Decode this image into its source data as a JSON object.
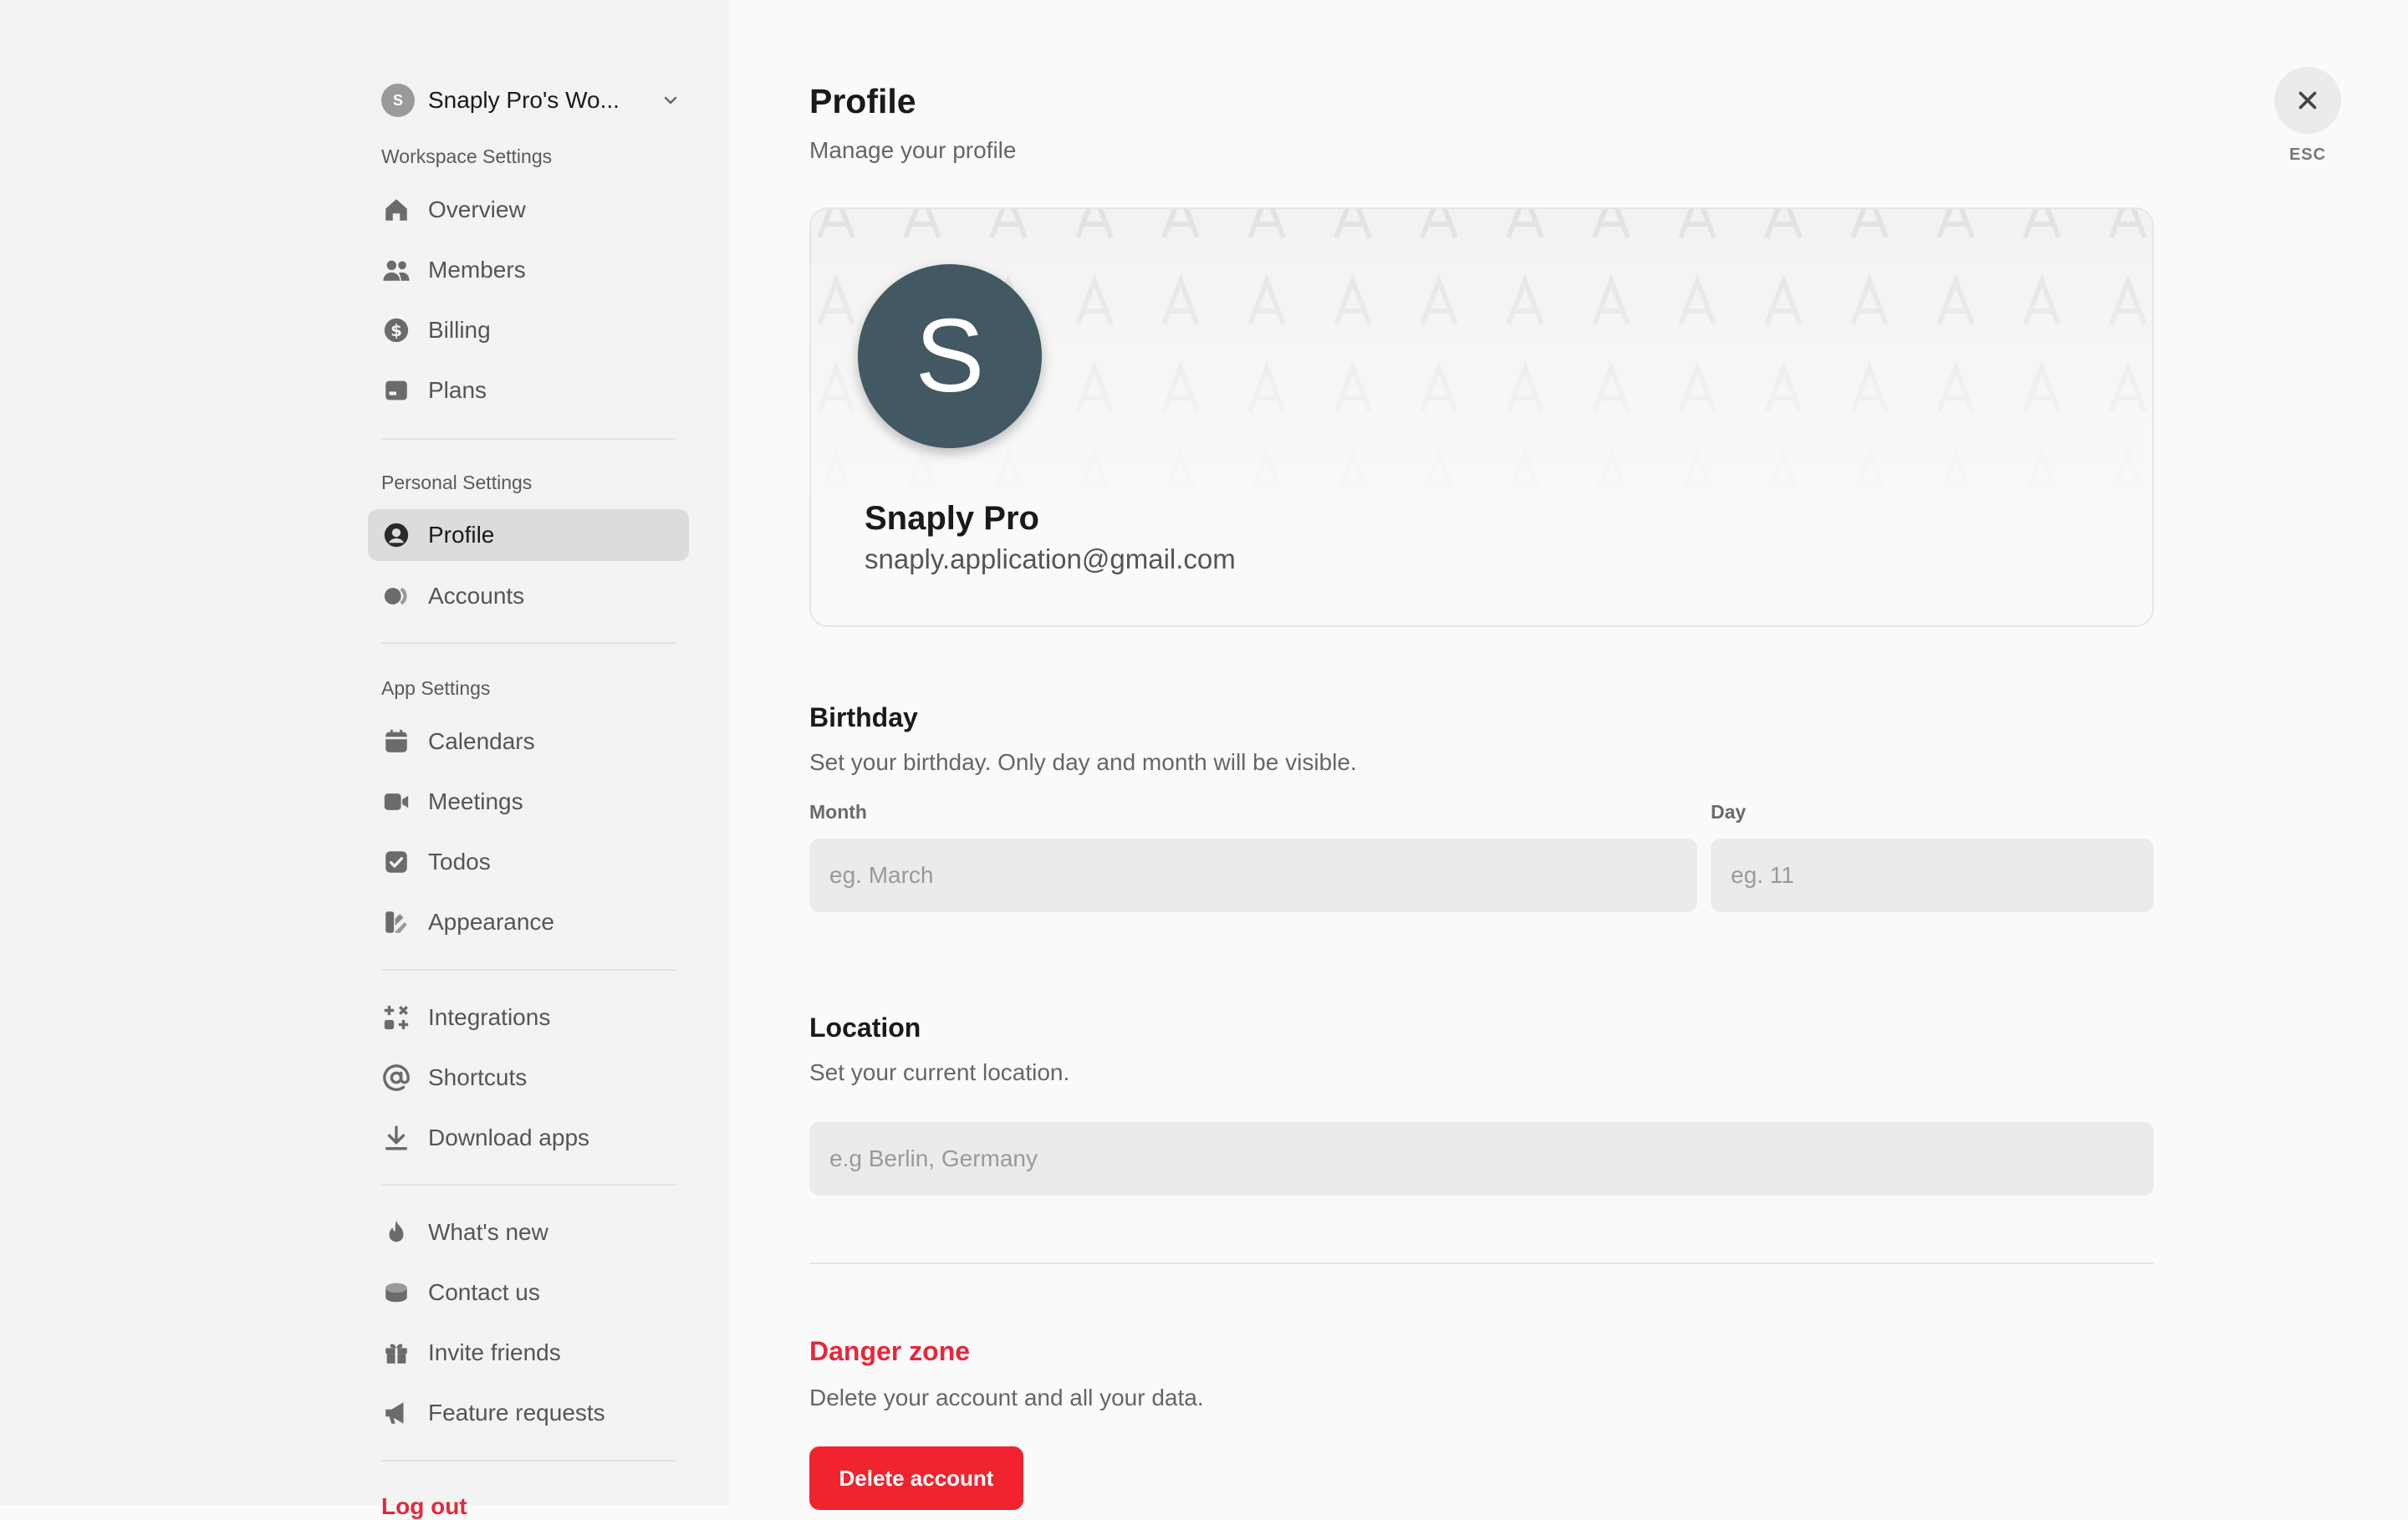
{
  "sidebar": {
    "workspace": {
      "avatar_letter": "S",
      "name": "Snaply Pro's Wo..."
    },
    "workspace_section": {
      "label": "Workspace Settings",
      "items": [
        {
          "label": "Overview",
          "icon": "home-icon"
        },
        {
          "label": "Members",
          "icon": "members-icon"
        },
        {
          "label": "Billing",
          "icon": "dollar-icon"
        },
        {
          "label": "Plans",
          "icon": "plans-icon"
        }
      ]
    },
    "personal_section": {
      "label": "Personal Settings",
      "items": [
        {
          "label": "Profile",
          "icon": "user-circle-icon",
          "active": true
        },
        {
          "label": "Accounts",
          "icon": "accounts-icon"
        }
      ]
    },
    "app_section": {
      "label": "App Settings",
      "items": [
        {
          "label": "Calendars",
          "icon": "calendar-icon"
        },
        {
          "label": "Meetings",
          "icon": "video-icon"
        },
        {
          "label": "Todos",
          "icon": "check-square-icon"
        },
        {
          "label": "Appearance",
          "icon": "palette-icon"
        }
      ]
    },
    "tools_section": {
      "items": [
        {
          "label": "Integrations",
          "icon": "integrations-icon"
        },
        {
          "label": "Shortcuts",
          "icon": "at-icon"
        },
        {
          "label": "Download apps",
          "icon": "download-icon"
        }
      ]
    },
    "misc_section": {
      "items": [
        {
          "label": "What's new",
          "icon": "flame-icon"
        },
        {
          "label": "Contact us",
          "icon": "inbox-icon"
        },
        {
          "label": "Invite friends",
          "icon": "gift-icon"
        },
        {
          "label": "Feature requests",
          "icon": "megaphone-icon"
        }
      ]
    },
    "logout_label": "Log out"
  },
  "main": {
    "title": "Profile",
    "subtitle": "Manage your profile",
    "close": {
      "label": "ESC",
      "icon": "close-icon"
    },
    "profile": {
      "avatar_letter": "S",
      "name": "Snaply Pro",
      "email": "snaply.application@gmail.com",
      "avatar_color": "#425862"
    },
    "birthday": {
      "title": "Birthday",
      "description": "Set your birthday. Only day and month will be visible.",
      "month_label": "Month",
      "month_placeholder": "eg. March",
      "day_label": "Day",
      "day_placeholder": "eg. 11"
    },
    "location": {
      "title": "Location",
      "description": "Set your current location.",
      "placeholder": "e.g Berlin, Germany"
    },
    "danger": {
      "title": "Danger zone",
      "description": "Delete your account and all your data.",
      "button_label": "Delete account",
      "color": "#f0232e"
    }
  }
}
